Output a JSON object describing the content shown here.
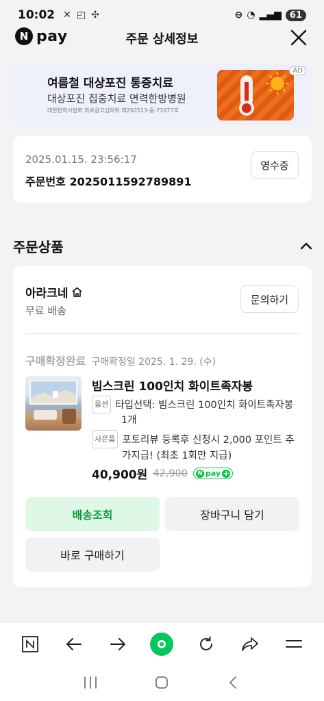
{
  "status_bar": {
    "time": "10:02",
    "battery": "61"
  },
  "header": {
    "logo_letter": "N",
    "logo_text": "pay",
    "title": "주문 상세정보"
  },
  "ad": {
    "title": "여름철 대상포진 통증치료",
    "subtitle": "대상포진 집중치료 면력한방병원",
    "fine_print": "대한한의사협회 의료광고심의위 제250513-중-71677호",
    "badge": "AD"
  },
  "order": {
    "date": "2025.01.15. 23:56:17",
    "number": "주문번호 2025011592789891",
    "receipt_label": "영수증"
  },
  "products_section": {
    "title": "주문상품"
  },
  "seller": {
    "name": "아라크네",
    "shipping": "무료 배송",
    "inquiry_label": "문의하기"
  },
  "item": {
    "status": "구매확정완료",
    "status_date": "구매확정일 2025. 1. 29. (수)",
    "name": "빔스크린 100인치 화이트족자봉",
    "option_tag": "옵션",
    "option_text": "타입선택: 빔스크린 100인치 화이트족자봉",
    "quantity": "1개",
    "gift_tag": "사은품",
    "gift_text_1": "포토리뷰 등록후 신청시 2,000 포인트 추",
    "gift_text_2": "가지급! (최초 1회만 지급)",
    "price": "40,900원",
    "original_price": "42,900",
    "npay_badge_letter": "N",
    "npay_badge_text": "pay"
  },
  "actions": {
    "track": "배송조회",
    "cart": "장바구니 담기",
    "buy_again": "바로 구매하기"
  },
  "colors": {
    "brand_green": "#03c75a",
    "track_text": "#0a9a37",
    "track_bg": "#dff7e6"
  }
}
